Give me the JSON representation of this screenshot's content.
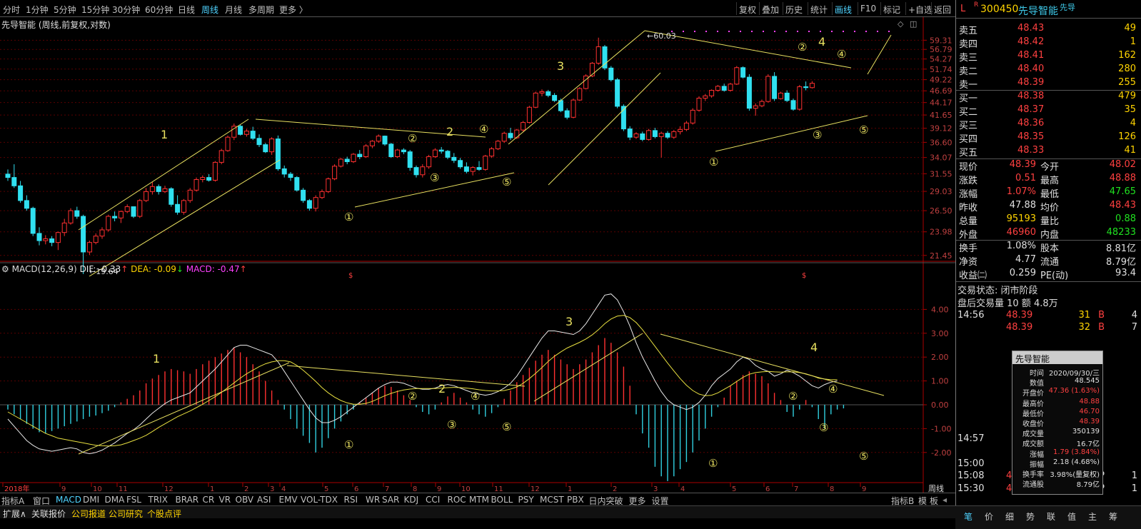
{
  "periods": [
    "分时",
    "1分钟",
    "5分钟",
    "15分钟",
    "30分钟",
    "60分钟",
    "日线",
    "周线",
    "月线",
    "多周期",
    "更多 〉"
  ],
  "active_period": "周线",
  "toolbar": [
    "复权",
    "叠加",
    "历史",
    "统计",
    "画线",
    "F10",
    "标记",
    "+自选",
    "返回"
  ],
  "chart_title": "先导智能 (周线,前复权,对数)",
  "price_axis": [
    "59.31",
    "56.79",
    "54.27",
    "51.74",
    "49.22",
    "46.69",
    "44.17",
    "41.65",
    "39.12",
    "36.60",
    "34.07",
    "31.55",
    "29.03",
    "26.50",
    "23.98",
    "21.45"
  ],
  "macd_axis": [
    "4.00",
    "3.00",
    "2.00",
    "1.00",
    "0.00",
    "-1.00",
    "-2.00"
  ],
  "price_markers": {
    "high": "60.03",
    "low": "19.64"
  },
  "wave_labels": {
    "w1": "1",
    "w2": "2",
    "w3": "3",
    "w4": "4",
    "c1": "①",
    "c2": "②",
    "c3": "③",
    "c4": "④",
    "c5": "⑤"
  },
  "time_axis": [
    "2018年",
    "9",
    "10",
    "11",
    "12",
    "1",
    "2",
    "3",
    "4",
    "5",
    "6",
    "7",
    "8",
    "9",
    "10",
    "11",
    "12",
    "1",
    "2",
    "3",
    "4",
    "5",
    "6",
    "7",
    "8",
    "9"
  ],
  "period_indicator": "周线",
  "macd": {
    "name": "MACD(12,26,9)",
    "dif": "DIF: -0.33",
    "dea": "DEA: -0.09",
    "macd": "MACD: -0.47",
    "up_arrow": "↑",
    "down_arrow": "↓"
  },
  "indicator_tabs": [
    "指标A",
    "窗口",
    "MACD",
    "DMI",
    "DMA",
    "FSL",
    "TRIX",
    "BRAR",
    "CR",
    "VR",
    "OBV",
    "ASI",
    "EMV",
    "VOL-TDX",
    "RSI",
    "WR",
    "SAR",
    "KDJ",
    "CCI",
    "ROC",
    "MTM",
    "BOLL",
    "PSY",
    "MCST",
    "PBX",
    "日内突破",
    "更多",
    "设置"
  ],
  "active_indicator": "MACD",
  "indicator_tail": {
    "b": "指标B",
    "model": "模",
    "board": "板"
  },
  "footer_tabs": [
    "扩展∧",
    "关联报价",
    "公司报道",
    "公司研究",
    "个股点评"
  ],
  "stock": {
    "flag": "L",
    "r": "R",
    "code": "300450",
    "name": "先导智能",
    "sub": "先导"
  },
  "asks": [
    {
      "label": "卖五",
      "price": "48.43",
      "vol": "49"
    },
    {
      "label": "卖四",
      "price": "48.42",
      "vol": "1"
    },
    {
      "label": "卖三",
      "price": "48.41",
      "vol": "162"
    },
    {
      "label": "卖二",
      "price": "48.40",
      "vol": "280"
    },
    {
      "label": "卖一",
      "price": "48.39",
      "vol": "255"
    }
  ],
  "bids": [
    {
      "label": "买一",
      "price": "48.38",
      "vol": "479"
    },
    {
      "label": "买二",
      "price": "48.37",
      "vol": "35"
    },
    {
      "label": "买三",
      "price": "48.36",
      "vol": "4"
    },
    {
      "label": "买四",
      "price": "48.35",
      "vol": "126"
    },
    {
      "label": "买五",
      "price": "48.33",
      "vol": "41"
    }
  ],
  "quote": [
    {
      "l1": "现价",
      "v1": "48.39",
      "c1": "red",
      "l2": "今开",
      "v2": "48.02",
      "c2": "red"
    },
    {
      "l1": "涨跌",
      "v1": "0.51",
      "c1": "red",
      "l2": "最高",
      "v2": "48.88",
      "c2": "red"
    },
    {
      "l1": "涨幅",
      "v1": "1.07%",
      "c1": "red",
      "l2": "最低",
      "v2": "47.65",
      "c2": "green"
    },
    {
      "l1": "昨收",
      "v1": "47.88",
      "c1": "white",
      "l2": "均价",
      "v2": "48.43",
      "c2": "red"
    },
    {
      "l1": "总量",
      "v1": "95193",
      "c1": "yellow",
      "l2": "量比",
      "v2": "0.88",
      "c2": "green"
    },
    {
      "l1": "外盘",
      "v1": "46960",
      "c1": "red",
      "l2": "内盘",
      "v2": "48233",
      "c2": "green"
    }
  ],
  "fundamentals": [
    {
      "l1": "换手",
      "v1": "1.08%",
      "l2": "股本",
      "v2": "8.81亿"
    },
    {
      "l1": "净资",
      "v1": "4.77",
      "l2": "流通",
      "v2": "8.79亿"
    },
    {
      "l1": "收益㈡",
      "v1": "0.259",
      "l2": "PE(动)",
      "v2": "93.4"
    }
  ],
  "trade_status": "交易状态: 闭市阶段",
  "after_hours": "盘后交易量 10 额 4.8万",
  "ticks": [
    {
      "time": "14:56",
      "price": "48.39",
      "vol": "31",
      "bs": "B",
      "n": "4"
    },
    {
      "time": "",
      "price": "48.39",
      "vol": "32",
      "bs": "B",
      "n": "7"
    },
    {
      "time": "14:57",
      "price": "",
      "vol": "",
      "bs": "",
      "n": ""
    },
    {
      "time": "15:00",
      "price": "",
      "vol": "",
      "bs": "",
      "n": ""
    },
    {
      "time": "15:08",
      "price": "48.39",
      "vol": "1",
      "bs": "P",
      "n": "1"
    },
    {
      "time": "15:30",
      "price": "48.39",
      "vol": "9",
      "bs": "P",
      "n": "1"
    }
  ],
  "popup": {
    "title": "先导智能",
    "rows": [
      {
        "l": "时间",
        "v": "2020/09/30/三",
        "c": "white"
      },
      {
        "l": "数值",
        "v": "48.545",
        "c": "white"
      },
      {
        "l": "开盘价",
        "v": "47.36 (1.63%)",
        "c": "red"
      },
      {
        "l": "最高价",
        "v": "48.88",
        "c": "red"
      },
      {
        "l": "最低价",
        "v": "46.70",
        "c": "red"
      },
      {
        "l": "收盘价",
        "v": "48.39",
        "c": "red"
      },
      {
        "l": "成交量",
        "v": "350139",
        "c": "white"
      },
      {
        "l": "成交额",
        "v": "16.7亿",
        "c": "white"
      },
      {
        "l": "涨幅",
        "v": "1.79 (3.84%)",
        "c": "red"
      },
      {
        "l": "振幅",
        "v": "2.18 (4.68%)",
        "c": "white"
      },
      {
        "l": "换手率",
        "v": "3.98%(量复权)",
        "c": "white"
      },
      {
        "l": "流通股",
        "v": "8.79亿",
        "c": "white"
      }
    ]
  },
  "right_footer": [
    "笔",
    "价",
    "细",
    "势",
    "联",
    "值",
    "主",
    "筹"
  ],
  "chart_data": {
    "type": "candlestick",
    "title": "先导智能 (周线,前复权,对数)",
    "scale": "log",
    "ylim": [
      19.5,
      61
    ],
    "high_label": 60.03,
    "low_label": 19.64,
    "candles": [
      [
        31.5,
        32.2,
        30.5,
        31.0
      ],
      [
        31.0,
        33.0,
        29.5,
        29.8
      ],
      [
        29.8,
        30.5,
        27.5,
        27.8
      ],
      [
        27.8,
        28.5,
        26.5,
        26.8
      ],
      [
        26.8,
        27.0,
        23.5,
        23.8
      ],
      [
        23.8,
        24.5,
        22.5,
        23.0
      ],
      [
        23.0,
        23.6,
        22.6,
        23.2
      ],
      [
        23.2,
        23.5,
        22.4,
        22.8
      ],
      [
        22.8,
        24.0,
        22.0,
        23.9
      ],
      [
        23.9,
        25.5,
        23.5,
        25.0
      ],
      [
        25.0,
        26.8,
        24.8,
        26.5
      ],
      [
        26.5,
        27.0,
        25.5,
        25.8
      ],
      [
        25.8,
        26.0,
        19.64,
        21.8
      ],
      [
        21.8,
        23.0,
        21.5,
        22.8
      ],
      [
        22.8,
        23.8,
        22.6,
        23.5
      ],
      [
        23.5,
        24.5,
        23.2,
        24.2
      ],
      [
        24.2,
        26.0,
        24.0,
        25.8
      ],
      [
        25.8,
        26.4,
        25.2,
        25.6
      ],
      [
        25.6,
        26.5,
        25.0,
        26.4
      ],
      [
        26.4,
        27.3,
        26.2,
        27.0
      ],
      [
        27.0,
        26.8,
        25.6,
        25.8
      ],
      [
        25.8,
        28.0,
        25.6,
        27.8
      ],
      [
        27.8,
        29.5,
        27.6,
        29.0
      ],
      [
        29.0,
        30.4,
        28.6,
        29.7
      ],
      [
        29.7,
        30.0,
        28.6,
        29.0
      ],
      [
        29.0,
        29.8,
        28.8,
        29.4
      ],
      [
        29.4,
        29.6,
        27.0,
        27.3
      ],
      [
        27.3,
        28.5,
        26.0,
        26.3
      ],
      [
        26.3,
        28.0,
        26.0,
        27.8
      ],
      [
        27.8,
        29.5,
        27.5,
        29.2
      ],
      [
        29.2,
        31.0,
        29.0,
        30.7
      ],
      [
        30.7,
        31.3,
        30.3,
        31.0
      ],
      [
        31.0,
        31.5,
        30.4,
        30.6
      ],
      [
        30.6,
        33.5,
        30.4,
        33.3
      ],
      [
        33.3,
        35.5,
        33.0,
        35.2
      ],
      [
        35.2,
        37.8,
        35.0,
        37.5
      ],
      [
        37.5,
        40.0,
        37.0,
        39.5
      ],
      [
        39.5,
        39.8,
        37.8,
        38.0
      ],
      [
        38.0,
        39.0,
        37.6,
        38.6
      ],
      [
        38.6,
        39.4,
        37.0,
        37.3
      ],
      [
        37.3,
        38.0,
        35.8,
        36.2
      ],
      [
        36.2,
        36.5,
        34.8,
        35.0
      ],
      [
        35.0,
        37.5,
        34.5,
        37.2
      ],
      [
        37.2,
        37.8,
        32.0,
        32.3
      ],
      [
        32.3,
        32.8,
        31.0,
        31.5
      ],
      [
        31.5,
        31.8,
        30.5,
        31.0
      ],
      [
        31.0,
        31.2,
        29.0,
        29.2
      ],
      [
        29.2,
        29.5,
        27.5,
        27.8
      ],
      [
        27.8,
        28.0,
        26.5,
        26.8
      ],
      [
        26.8,
        28.5,
        26.4,
        28.2
      ],
      [
        28.2,
        29.3,
        28.0,
        29.0
      ],
      [
        29.0,
        31.0,
        28.8,
        30.8
      ],
      [
        30.8,
        33.0,
        30.6,
        32.7
      ],
      [
        32.7,
        34.0,
        32.5,
        33.8
      ],
      [
        33.8,
        34.2,
        33.0,
        33.4
      ],
      [
        33.4,
        34.8,
        33.2,
        34.6
      ],
      [
        34.6,
        35.3,
        33.8,
        34.2
      ],
      [
        34.2,
        36.3,
        34.0,
        36.0
      ],
      [
        36.0,
        37.0,
        35.6,
        36.8
      ],
      [
        36.8,
        38.0,
        36.5,
        37.7
      ],
      [
        37.7,
        37.8,
        36.0,
        36.3
      ],
      [
        36.3,
        36.5,
        34.0,
        34.2
      ],
      [
        34.2,
        35.5,
        34.0,
        35.3
      ],
      [
        35.3,
        35.6,
        34.6,
        35.0
      ],
      [
        35.0,
        35.3,
        32.0,
        32.5
      ],
      [
        32.5,
        32.8,
        31.0,
        31.4
      ],
      [
        31.4,
        33.0,
        31.0,
        32.6
      ],
      [
        32.6,
        34.5,
        32.3,
        34.2
      ],
      [
        34.2,
        35.6,
        34.0,
        35.3
      ],
      [
        35.3,
        35.8,
        34.7,
        35.1
      ],
      [
        35.1,
        35.3,
        33.8,
        34.1
      ],
      [
        34.1,
        34.8,
        33.2,
        33.6
      ],
      [
        33.6,
        34.0,
        32.3,
        32.6
      ],
      [
        32.6,
        33.3,
        31.6,
        31.9
      ],
      [
        31.9,
        32.7,
        31.3,
        32.5
      ],
      [
        32.5,
        33.5,
        32.0,
        32.2
      ],
      [
        32.2,
        34.5,
        32.0,
        34.3
      ],
      [
        34.3,
        35.8,
        34.0,
        35.5
      ],
      [
        35.5,
        37.0,
        35.3,
        36.8
      ],
      [
        36.8,
        38.5,
        36.5,
        38.2
      ],
      [
        38.2,
        39.2,
        37.0,
        37.4
      ],
      [
        37.4,
        39.0,
        37.2,
        38.8
      ],
      [
        38.8,
        40.5,
        38.5,
        40.2
      ],
      [
        40.2,
        43.5,
        40.0,
        43.2
      ],
      [
        43.2,
        46.5,
        43.0,
        46.2
      ],
      [
        46.2,
        47.0,
        45.5,
        46.5
      ],
      [
        46.5,
        46.9,
        45.3,
        45.7
      ],
      [
        45.7,
        46.2,
        44.3,
        44.6
      ],
      [
        44.6,
        45.0,
        42.2,
        42.5
      ],
      [
        42.5,
        43.0,
        40.8,
        41.2
      ],
      [
        41.2,
        45.0,
        41.0,
        44.7
      ],
      [
        44.7,
        47.5,
        44.5,
        47.2
      ],
      [
        47.2,
        50.5,
        47.0,
        50.1
      ],
      [
        50.1,
        53.5,
        49.8,
        53.2
      ],
      [
        53.2,
        60.03,
        52.8,
        57.5
      ],
      [
        57.5,
        58.0,
        51.5,
        52.0
      ],
      [
        52.0,
        52.5,
        48.8,
        49.2
      ],
      [
        49.2,
        49.6,
        43.0,
        43.4
      ],
      [
        43.4,
        43.8,
        38.6,
        39.0
      ],
      [
        39.0,
        39.5,
        37.0,
        37.5
      ],
      [
        37.5,
        38.4,
        37.2,
        38.1
      ],
      [
        38.1,
        38.5,
        36.8,
        37.1
      ],
      [
        37.1,
        39.0,
        36.9,
        38.7
      ],
      [
        38.7,
        39.2,
        37.3,
        37.6
      ],
      [
        37.6,
        38.5,
        34.07,
        38.2
      ],
      [
        38.2,
        38.6,
        37.2,
        37.5
      ],
      [
        37.5,
        38.8,
        37.2,
        38.5
      ],
      [
        38.5,
        39.5,
        38.0,
        38.9
      ],
      [
        38.9,
        40.5,
        38.6,
        40.1
      ],
      [
        40.1,
        43.0,
        39.8,
        42.6
      ],
      [
        42.6,
        45.5,
        42.3,
        45.1
      ],
      [
        45.1,
        46.0,
        44.5,
        45.6
      ],
      [
        45.6,
        47.0,
        45.2,
        46.8
      ],
      [
        46.8,
        48.0,
        46.5,
        47.7
      ],
      [
        47.7,
        48.3,
        46.5,
        46.8
      ],
      [
        46.8,
        48.5,
        46.5,
        48.2
      ],
      [
        48.2,
        52.5,
        48.0,
        52.1
      ],
      [
        52.1,
        52.4,
        49.5,
        49.8
      ],
      [
        49.8,
        50.5,
        42.5,
        43.0
      ],
      [
        43.0,
        44.0,
        41.5,
        43.5
      ],
      [
        43.5,
        44.8,
        43.2,
        44.4
      ],
      [
        44.4,
        50.5,
        44.2,
        50.0
      ],
      [
        50.0,
        51.0,
        44.5,
        45.0
      ],
      [
        45.0,
        46.5,
        44.8,
        46.2
      ],
      [
        46.2,
        46.8,
        44.3,
        44.6
      ],
      [
        44.6,
        45.0,
        42.5,
        42.8
      ],
      [
        42.8,
        48.0,
        42.5,
        47.6
      ],
      [
        47.6,
        48.8,
        46.8,
        47.4
      ],
      [
        47.4,
        48.88,
        47.2,
        48.39
      ]
    ],
    "macd_hist": [
      -0.2,
      -0.4,
      -0.6,
      -0.8,
      -1.0,
      -1.15,
      -1.2,
      -1.1,
      -1.0,
      -0.9,
      -0.8,
      -0.7,
      -0.6,
      -0.5,
      -0.45,
      -0.35,
      -0.25,
      -0.1,
      0.1,
      0.25,
      0.4,
      0.6,
      0.9,
      1.1,
      1.25,
      1.4,
      1.5,
      1.45,
      1.4,
      1.3,
      1.5,
      1.7,
      1.85,
      2.0,
      2.15,
      2.3,
      2.4,
      2.2,
      2.0,
      1.7,
      1.4,
      1.0,
      0.6,
      0.2,
      -0.2,
      -0.6,
      -1.0,
      -1.3,
      -1.6,
      -2.0,
      -1.8,
      -1.4,
      -1.0,
      -0.7,
      -0.4,
      -0.2,
      0.1,
      0.3,
      0.5,
      0.7,
      0.8,
      0.75,
      0.6,
      0.4,
      0.2,
      -0.1,
      -0.3,
      -0.4,
      -0.2,
      0.1,
      0.35,
      0.5,
      0.3,
      0.1,
      -0.2,
      -0.4,
      -0.5,
      -0.35,
      -0.1,
      0.25,
      0.6,
      0.95,
      1.25,
      1.55,
      1.85,
      2.1,
      2.3,
      2.1,
      1.9,
      1.7,
      1.5,
      1.7,
      1.9,
      2.2,
      2.5,
      2.8,
      2.6,
      2.2,
      1.6,
      0.8,
      -0.4,
      -1.2,
      -1.8,
      -2.6,
      -3.0,
      -3.2,
      -3.0,
      -2.7,
      -2.4,
      -2.0,
      -1.5,
      -1.0,
      -0.5,
      -0.1,
      0.3,
      0.8,
      1.0,
      1.25,
      1.4,
      1.3,
      1.2,
      0.9,
      0.5,
      0.2,
      -0.3,
      -0.5,
      -0.2,
      0.2,
      -0.1,
      -0.6,
      -1.0,
      -0.4,
      -0.2,
      -0.15
    ],
    "dif": [
      -0.6,
      -0.9,
      -1.2,
      -1.5,
      -1.7,
      -1.85,
      -1.9,
      -1.95,
      -1.9,
      -1.85,
      -1.8,
      -1.85,
      -2.0,
      -2.05,
      -2.0,
      -1.9,
      -1.75,
      -1.6,
      -1.4,
      -1.2,
      -1.05,
      -0.85,
      -0.6,
      -0.35,
      -0.15,
      0.05,
      0.2,
      0.3,
      0.4,
      0.5,
      0.75,
      1.0,
      1.25,
      1.5,
      1.8,
      2.1,
      2.4,
      2.5,
      2.5,
      2.4,
      2.3,
      2.2,
      2.1,
      1.8,
      1.4,
      1.0,
      0.6,
      0.2,
      -0.2,
      -0.55,
      -0.75,
      -0.75,
      -0.65,
      -0.5,
      -0.3,
      -0.1,
      0.1,
      0.3,
      0.5,
      0.7,
      0.85,
      0.95,
      0.95,
      0.9,
      0.8,
      0.7,
      0.65,
      0.65,
      0.7,
      0.8,
      0.85,
      0.8,
      0.7,
      0.6,
      0.5,
      0.45,
      0.4,
      0.45,
      0.55,
      0.7,
      0.9,
      1.2,
      1.6,
      2.0,
      2.4,
      2.8,
      3.1,
      3.1,
      3.05,
      3.0,
      2.95,
      3.1,
      3.4,
      3.8,
      4.2,
      4.6,
      4.65,
      4.4,
      3.9,
      3.3,
      2.6,
      2.0,
      1.5,
      1.0,
      0.55,
      0.2,
      0.0,
      -0.1,
      -0.2,
      -0.1,
      0.1,
      0.4,
      0.8,
      1.1,
      1.3,
      1.5,
      1.8,
      2.0,
      1.9,
      1.65,
      1.5,
      1.4,
      1.2,
      1.3,
      1.45,
      1.35,
      1.2,
      1.0,
      0.8,
      0.7,
      0.85,
      0.95,
      1.0
    ],
    "dea": [
      -0.3,
      -0.45,
      -0.6,
      -0.75,
      -0.9,
      -1.05,
      -1.2,
      -1.3,
      -1.4,
      -1.45,
      -1.5,
      -1.55,
      -1.6,
      -1.65,
      -1.7,
      -1.72,
      -1.73,
      -1.72,
      -1.68,
      -1.6,
      -1.5,
      -1.4,
      -1.28,
      -1.12,
      -0.95,
      -0.8,
      -0.65,
      -0.5,
      -0.38,
      -0.26,
      -0.12,
      0.02,
      0.18,
      0.34,
      0.52,
      0.72,
      0.92,
      1.12,
      1.3,
      1.45,
      1.6,
      1.72,
      1.8,
      1.85,
      1.85,
      1.8,
      1.65,
      1.45,
      1.22,
      0.98,
      0.72,
      0.5,
      0.32,
      0.18,
      0.08,
      0.02,
      0.02,
      0.06,
      0.14,
      0.26,
      0.38,
      0.48,
      0.56,
      0.62,
      0.66,
      0.68,
      0.68,
      0.68,
      0.68,
      0.7,
      0.72,
      0.73,
      0.72,
      0.7,
      0.67,
      0.63,
      0.6,
      0.58,
      0.58,
      0.6,
      0.66,
      0.75,
      0.9,
      1.1,
      1.32,
      1.56,
      1.82,
      2.04,
      2.22,
      2.38,
      2.5,
      2.62,
      2.76,
      2.93,
      3.15,
      3.4,
      3.6,
      3.72,
      3.75,
      3.66,
      3.45,
      3.15,
      2.8,
      2.45,
      2.1,
      1.75,
      1.42,
      1.1,
      0.82,
      0.6,
      0.45,
      0.38,
      0.4,
      0.5,
      0.65,
      0.8,
      0.98,
      1.15,
      1.28,
      1.35,
      1.38,
      1.4,
      1.38,
      1.37,
      1.38,
      1.38,
      1.35,
      1.3,
      1.22,
      1.12,
      1.08,
      1.05,
      1.05
    ]
  }
}
